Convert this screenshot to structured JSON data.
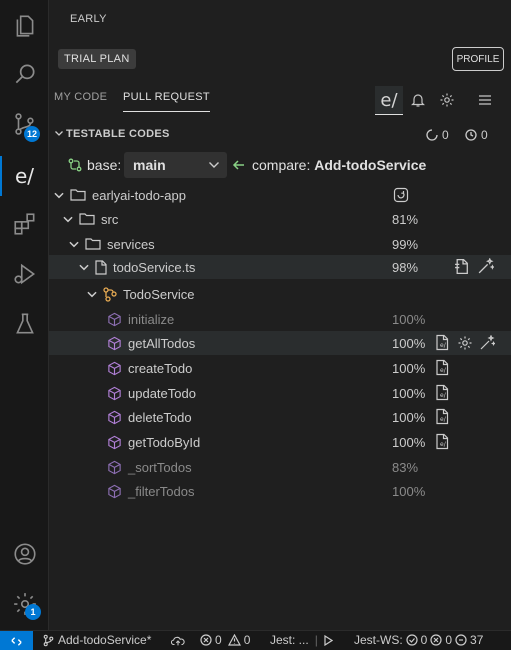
{
  "activity_bar": {
    "items": [
      {
        "name": "explorer"
      },
      {
        "name": "search"
      },
      {
        "name": "source-control",
        "badge": "12"
      },
      {
        "name": "earlyai"
      },
      {
        "name": "extensions"
      },
      {
        "name": "run-debug"
      },
      {
        "name": "testing"
      }
    ],
    "accounts_badge": "",
    "manage_badge": "1",
    "accent_color": "#0078d4"
  },
  "panel": {
    "title": "EARLY",
    "trial_label": "TRIAL PLAN",
    "profile_label": "PROFILE",
    "tabs": [
      {
        "label": "MY CODE",
        "active": false
      },
      {
        "label": "PULL REQUEST",
        "active": true
      }
    ],
    "logo_text": "e/",
    "section_title": "TESTABLE CODES",
    "counters": [
      "0",
      "0"
    ],
    "base_label": "base:",
    "base_value": "main",
    "compare_label": "compare:",
    "compare_value": "Add-todoService"
  },
  "tree": [
    {
      "name": "earlyai-todo-app",
      "type": "folder",
      "coverage": ""
    },
    {
      "name": "src",
      "type": "folder",
      "coverage": "81%"
    },
    {
      "name": "services",
      "type": "folder",
      "coverage": "99%"
    },
    {
      "name": "todoService.ts",
      "type": "file",
      "coverage": "98%"
    },
    {
      "name": "TodoService",
      "type": "class",
      "coverage": ""
    },
    {
      "name": "initialize",
      "type": "method",
      "coverage": "100%",
      "dim": true
    },
    {
      "name": "getAllTodos",
      "type": "method",
      "coverage": "100%"
    },
    {
      "name": "createTodo",
      "type": "method",
      "coverage": "100%"
    },
    {
      "name": "updateTodo",
      "type": "method",
      "coverage": "100%"
    },
    {
      "name": "deleteTodo",
      "type": "method",
      "coverage": "100%"
    },
    {
      "name": "getTodoById",
      "type": "method",
      "coverage": "100%"
    },
    {
      "name": "_sortTodos",
      "type": "method",
      "coverage": "83%",
      "dim": true
    },
    {
      "name": "_filterTodos",
      "type": "method",
      "coverage": "100%",
      "dim": true
    }
  ],
  "statusbar": {
    "branch": "Add-todoService*",
    "errors": "0",
    "warnings": "0",
    "jest": "Jest: ...",
    "jest_ws": "Jest-WS:",
    "ws_pass": "0",
    "ws_fail": "0",
    "ws_skip": "37"
  }
}
